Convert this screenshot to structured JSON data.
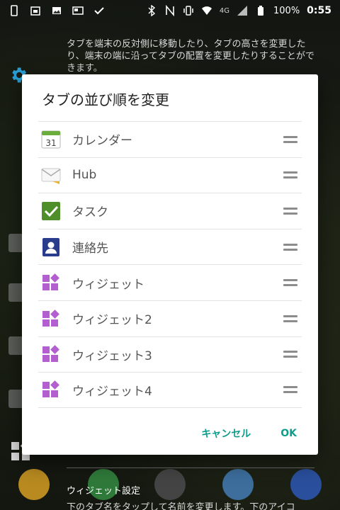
{
  "status_bar": {
    "network": "4G",
    "battery": "100%",
    "time": "0:55"
  },
  "background": {
    "description": "タブを端末の反対側に移動したり、タブの高さを変更したり、端末の端に沿ってタブの配置を変更したりすることができます。",
    "section_title": "ウィジェット設定",
    "section_desc": "下のタブ名をタップして名前を変更します。下のアイコ"
  },
  "dialog": {
    "title": "タブの並び順を変更",
    "items": [
      {
        "label": "カレンダー",
        "icon": "calendar-icon",
        "icon_text": "31"
      },
      {
        "label": "Hub",
        "icon": "hub-mail-icon"
      },
      {
        "label": "タスク",
        "icon": "tasks-check-icon"
      },
      {
        "label": "連絡先",
        "icon": "contacts-icon"
      },
      {
        "label": "ウィジェット",
        "icon": "widget-icon"
      },
      {
        "label": "ウィジェット2",
        "icon": "widget-icon"
      },
      {
        "label": "ウィジェット3",
        "icon": "widget-icon"
      },
      {
        "label": "ウィジェット4",
        "icon": "widget-icon"
      }
    ],
    "cancel_label": "キャンセル",
    "ok_label": "OK"
  },
  "colors": {
    "accent": "#0e9d8b",
    "widget_purple": "#b35fd0",
    "task_green": "#4e8f2c",
    "contact_navy": "#2a3c8c"
  }
}
